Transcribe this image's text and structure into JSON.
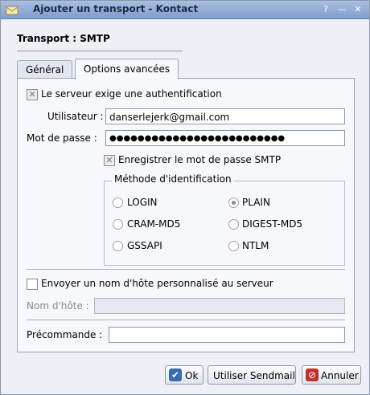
{
  "window": {
    "title": "Ajouter un transport - Kontact",
    "help_glyph": "?",
    "minimize_glyph": "—",
    "close_glyph": "✕"
  },
  "header": "Transport : SMTP",
  "tabs": [
    "Général",
    "Options avancées"
  ],
  "auth": {
    "required_label": "Le serveur exige une authentification",
    "user_label": "Utilisateur :",
    "user_value": "danserlejerk@gmail.com",
    "password_label": "Mot de passe :",
    "password_value": "●●●●●●●●●●●●●●●●●●●●●●●●●",
    "save_password_label": "Enregistrer le mot de passe SMTP"
  },
  "method": {
    "title": "Méthode d'identification",
    "options": [
      "LOGIN",
      "PLAIN",
      "CRAM-MD5",
      "DIGEST-MD5",
      "GSSAPI",
      "NTLM"
    ],
    "selected": "PLAIN"
  },
  "hostname": {
    "send_label": "Envoyer un nom d'hôte personnalisé au serveur",
    "hostname_label": "Nom d'hôte :",
    "hostname_value": ""
  },
  "precommand": {
    "label": "Précommande :",
    "value": ""
  },
  "buttons": {
    "ok": "Ok",
    "sendmail": "Utiliser Sendmail",
    "cancel": "Annuler"
  },
  "colors": {
    "accent": "#7f9ccb",
    "ok_icon": "#3a6ab0",
    "cancel_icon": "#c0302a"
  }
}
